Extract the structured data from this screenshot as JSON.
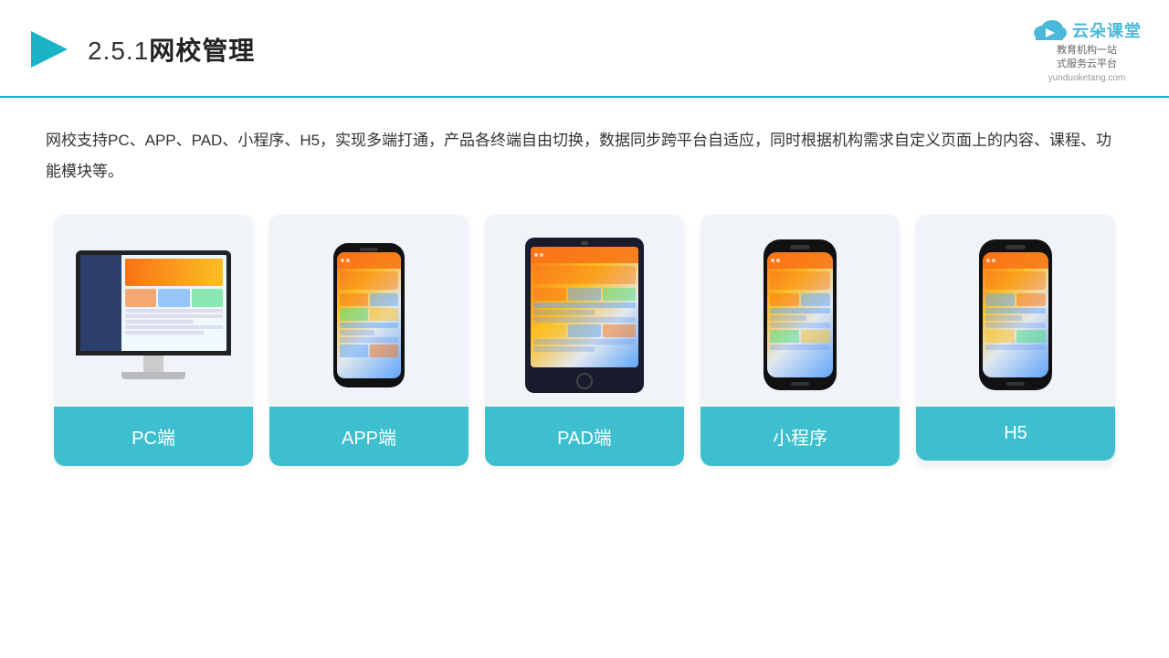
{
  "header": {
    "title": "2.5.1网校管理",
    "title_num": "2.5.1",
    "title_text": "网校管理",
    "logo_main": "云朵课堂",
    "logo_domain": "yunduoketang.com",
    "logo_tagline": "教育机构一站\n式服务云平台"
  },
  "description": "网校支持PC、APP、PAD、小程序、H5，实现多端打通，产品各终端自由切换，数据同步跨平台自适应，同时根据机构需求自定义页面上的内容、课程、功能模块等。",
  "cards": [
    {
      "id": "pc",
      "label": "PC端",
      "device": "monitor"
    },
    {
      "id": "app",
      "label": "APP端",
      "device": "phone-app"
    },
    {
      "id": "pad",
      "label": "PAD端",
      "device": "tablet"
    },
    {
      "id": "mini",
      "label": "小程序",
      "device": "phone"
    },
    {
      "id": "h5",
      "label": "H5",
      "device": "phone"
    }
  ],
  "colors": {
    "accent": "#3dbfcf",
    "header_border": "#1ab3c8",
    "card_bg": "#f0f4f8",
    "label_bg": "#3dbfcf"
  }
}
